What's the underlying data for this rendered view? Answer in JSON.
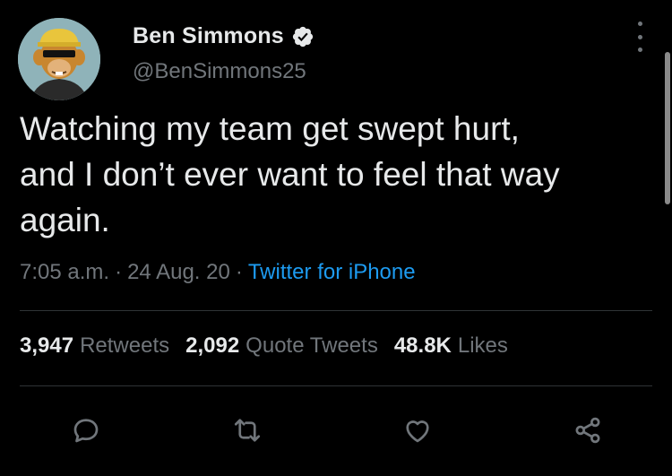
{
  "author": {
    "display_name": "Ben Simmons",
    "handle": "@BenSimmons25",
    "verified": true,
    "avatar": "bored-ape-avatar"
  },
  "tweet": {
    "text": "Watching my team get swept hurt,\nand I don’t ever want to feel that way\nagain.",
    "time": "7:05 a.m.",
    "separator": "·",
    "date": "24 Aug. 20",
    "source": "Twitter for iPhone"
  },
  "stats": {
    "retweets_count": "3,947",
    "retweets_label": "Retweets",
    "quotes_count": "2,092",
    "quotes_label": "Quote Tweets",
    "likes_count": "48.8K",
    "likes_label": "Likes"
  },
  "actions": [
    "reply-icon",
    "retweet-icon",
    "like-icon",
    "share-icon"
  ],
  "colors": {
    "background": "#000000",
    "text": "#e7e9ea",
    "muted": "#71767b",
    "link": "#1d9bf0",
    "divider": "#2f3336"
  }
}
